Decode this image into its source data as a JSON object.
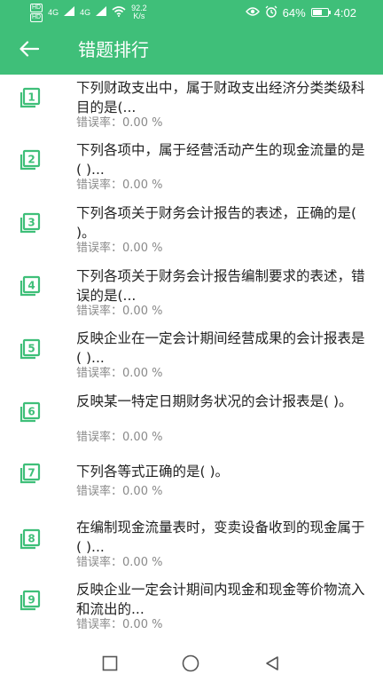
{
  "status_bar": {
    "left_tags": [
      "HD",
      "HD"
    ],
    "signal_1": "4G",
    "signal_2": "4G",
    "net_speed_value": "92.2",
    "net_speed_unit": "K/s",
    "battery_text": "64%",
    "battery_level": 0.64,
    "time": "4:02"
  },
  "app_bar": {
    "title": "错题排行",
    "back_icon": "arrow-left-icon",
    "background_color": "#3fbf79"
  },
  "error_label": "错误率：",
  "questions": [
    {
      "number": "1",
      "text": "下列财政支出中，属于财政支出经济分类类级科目的是(...",
      "rate": "0.00 %"
    },
    {
      "number": "2",
      "text": "下列各项中，属于经营活动产生的现金流量的是( )...",
      "rate": "0.00 %"
    },
    {
      "number": "3",
      "text": "下列各项关于财务会计报告的表述，正确的是( )。",
      "rate": "0.00 %"
    },
    {
      "number": "4",
      "text": "下列各项关于财务会计报告编制要求的表述，错误的是(...",
      "rate": "0.00 %"
    },
    {
      "number": "5",
      "text": "反映企业在一定会计期间经营成果的会计报表是( )...",
      "rate": "0.00 %"
    },
    {
      "number": "6",
      "text": "反映某一特定日期财务状况的会计报表是( )。",
      "rate": "0.00 %"
    },
    {
      "number": "7",
      "text": "下列各等式正确的是( )。",
      "rate": "0.00 %"
    },
    {
      "number": "8",
      "text": "在编制现金流量表时，变卖设备收到的现金属于( )...",
      "rate": "0.00 %"
    },
    {
      "number": "9",
      "text": "反映企业一定会计期间内现金和现金等价物流入和流出的...",
      "rate": "0.00 %"
    }
  ],
  "nav_bar": {
    "recent_icon": "square-icon",
    "home_icon": "circle-icon",
    "back_icon": "triangle-back-icon"
  }
}
